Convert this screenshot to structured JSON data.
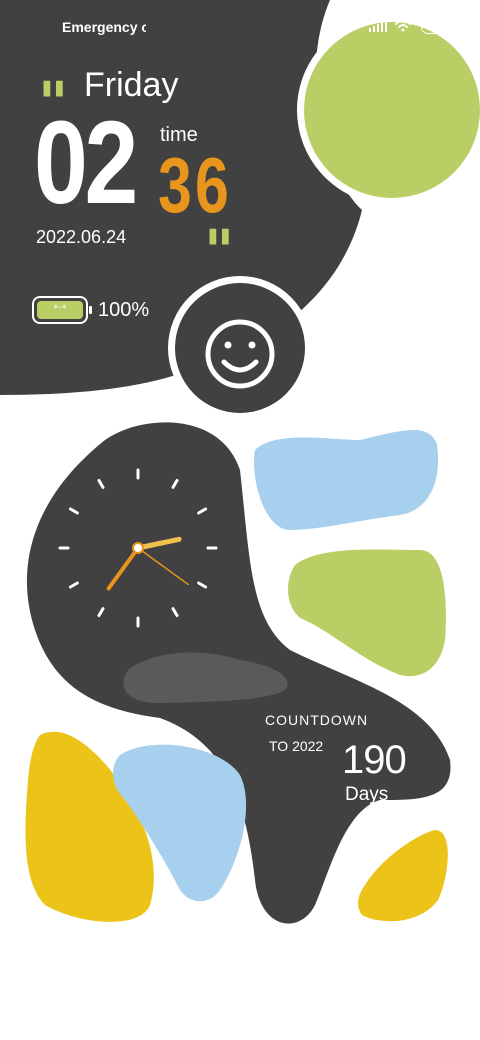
{
  "status_bar": {
    "carrier": "Emergency c",
    "battery_level": "100",
    "icons": [
      "signal-icon",
      "wifi-icon",
      "battery-icon"
    ]
  },
  "widget": {
    "day": "Friday",
    "hour": "02",
    "time_label": "time",
    "minute": "36",
    "date": "2022.06.24",
    "battery_face": "*ᵕ*",
    "battery_percent": "100%",
    "countdown_title": "COUNTDOWN",
    "countdown_subtitle": "TO 2022",
    "countdown_days": "190",
    "countdown_unit": "Days"
  },
  "colors": {
    "dark": "#414141",
    "green": "#b9cf66",
    "blue": "#a7d0ee",
    "yellow": "#ecc319",
    "orange": "#e8951d"
  },
  "analog_clock": {
    "hour": 2,
    "minute": 36,
    "second": 21
  }
}
